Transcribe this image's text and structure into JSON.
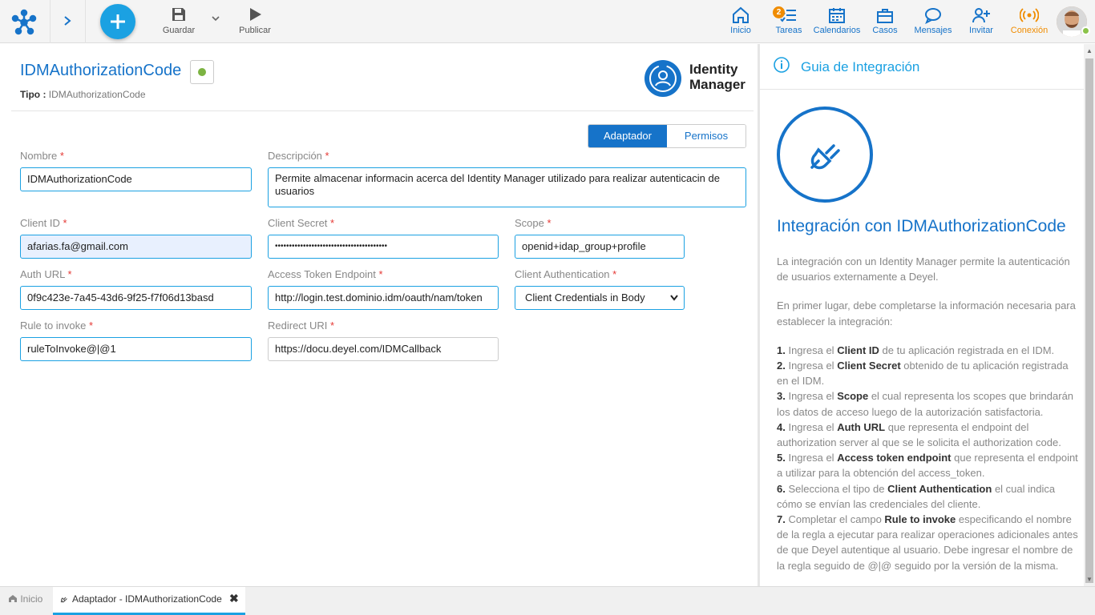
{
  "toolbar": {
    "guardar": "Guardar",
    "publicar": "Publicar"
  },
  "nav": {
    "inicio": "Inicio",
    "tareas": "Tareas",
    "tareas_badge": "2",
    "calendarios": "Calendarios",
    "casos": "Casos",
    "mensajes": "Mensajes",
    "invitar": "Invitar",
    "conexion": "Conexión"
  },
  "colors": {
    "primary": "#1673c9",
    "accent": "#1ba1e2",
    "warning": "#f08c00",
    "status_ok": "#7cb342"
  },
  "header": {
    "title": "IDMAuthorizationCode",
    "tipo_label": "Tipo :",
    "tipo_value": "IDMAuthorizationCode",
    "logo_line1": "Identity",
    "logo_line2": "Manager"
  },
  "tabs": {
    "adaptador": "Adaptador",
    "permisos": "Permisos"
  },
  "form": {
    "required_mark": "*",
    "nombre_label": "Nombre",
    "nombre_value": "IDMAuthorizationCode",
    "descripcion_label": "Descripción",
    "descripcion_value": "Permite almacenar informacin acerca del Identity Manager utilizado para realizar autenticacin de usuarios",
    "client_id_label": "Client ID",
    "client_id_value": "afarias.fa@gmail.com",
    "client_secret_label": "Client Secret",
    "client_secret_value": "••••••••••••••••••••••••••••••••••••••••",
    "scope_label": "Scope",
    "scope_value": "openid+idap_group+profile",
    "auth_url_label": "Auth URL",
    "auth_url_value": "0f9c423e-7a45-43d6-9f25-f7f06d13basd",
    "access_token_label": "Access Token Endpoint",
    "access_token_value": "http://login.test.dominio.idm/oauth/nam/token",
    "client_auth_label": "Client Authentication",
    "client_auth_value": "Client Credentials in Body",
    "rule_label": "Rule to invoke",
    "rule_value": "ruleToInvoke@|@1",
    "redirect_label": "Redirect URI",
    "redirect_value": "https://docu.deyel.com/IDMCallback"
  },
  "panel": {
    "title": "Guia de Integración",
    "heading": "Integración con IDMAuthorizationCode",
    "intro1": "La integración con un Identity Manager permite la autenticación de usuarios externamente a Deyel.",
    "intro2": "En primer lugar, debe completarse la información necesaria para establecer la integración:",
    "steps": [
      {
        "num": "1.",
        "pre": "Ingresa el",
        "key": "Client ID",
        "post": "de tu aplicación registrada en el IDM."
      },
      {
        "num": "2.",
        "pre": "Ingresa el",
        "key": "Client Secret",
        "post": "obtenido de tu aplicación registrada en el IDM."
      },
      {
        "num": "3.",
        "pre": "Ingresa el",
        "key": "Scope",
        "post": "el cual representa los scopes que brindarán los datos de acceso luego de la autorización satisfactoria."
      },
      {
        "num": "4.",
        "pre": "Ingresa el",
        "key": "Auth URL",
        "post": "que representa el endpoint del authorization server al que se le solicita el authorization code."
      },
      {
        "num": "5.",
        "pre": "Ingresa el",
        "key": "Access token endpoint",
        "post": "que representa el endpoint a utilizar para la obtención del access_token."
      },
      {
        "num": "6.",
        "pre": "Selecciona el tipo de",
        "key": "Client Authentication",
        "post": "el cual indica cómo se envían las credenciales del cliente."
      },
      {
        "num": "7.",
        "pre": "Completar el campo",
        "key": "Rule to invoke",
        "post": "especificando el nombre de la regla a ejecutar para realizar operaciones adicionales antes de que Deyel autentique al usuario. Debe ingresar el nombre de la regla seguido de @|@ seguido por la versión de la misma."
      }
    ]
  },
  "bottom": {
    "home": "Inicio",
    "active_tab": "Adaptador - IDMAuthorizationCode"
  }
}
